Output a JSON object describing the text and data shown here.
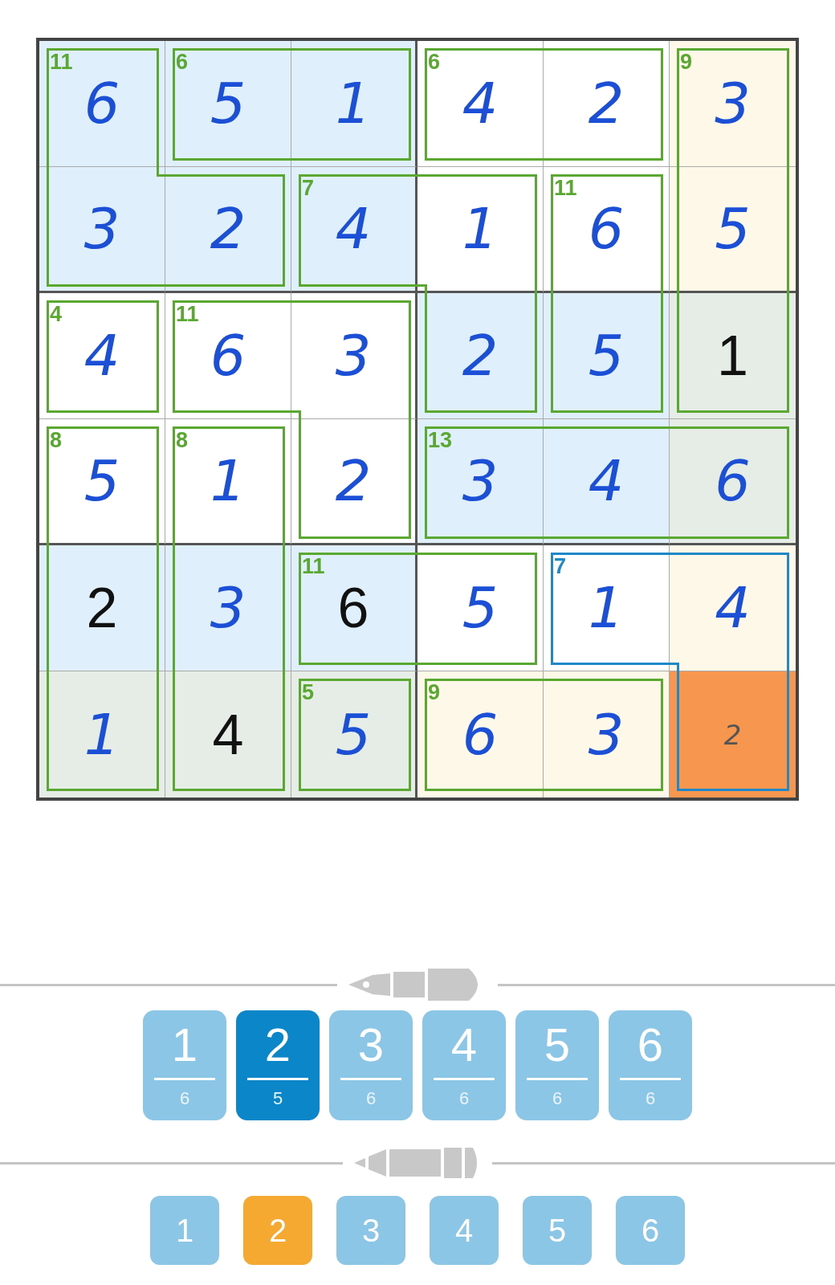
{
  "grid": {
    "rows": [
      [
        {
          "value": "6",
          "kind": "entered",
          "color": "#dfeffb",
          "selected": false,
          "cage_sum": "11",
          "cage_selected": false,
          "edges": {
            "top": true,
            "right": true,
            "bottom": false,
            "left": true
          }
        },
        {
          "value": "5",
          "kind": "entered",
          "color": "#dfeffb",
          "selected": false,
          "cage_sum": "6",
          "cage_selected": false,
          "edges": {
            "top": true,
            "right": false,
            "bottom": true,
            "left": true
          }
        },
        {
          "value": "1",
          "kind": "entered",
          "color": "#dfeffb",
          "selected": false,
          "cage_selected": false,
          "edges": {
            "top": true,
            "right": true,
            "bottom": true,
            "left": false
          }
        },
        {
          "value": "4",
          "kind": "entered",
          "color": "#ffffff",
          "selected": false,
          "cage_sum": "6",
          "cage_selected": false,
          "edges": {
            "top": true,
            "right": false,
            "bottom": true,
            "left": true
          }
        },
        {
          "value": "2",
          "kind": "entered",
          "color": "#ffffff",
          "selected": false,
          "cage_selected": false,
          "edges": {
            "top": true,
            "right": true,
            "bottom": true,
            "left": false
          }
        },
        {
          "value": "3",
          "kind": "entered",
          "color": "#fdf8e8",
          "selected": false,
          "cage_sum": "9",
          "cage_selected": false,
          "edges": {
            "top": true,
            "right": true,
            "bottom": false,
            "left": true
          }
        }
      ],
      [
        {
          "value": "3",
          "kind": "entered",
          "color": "#dfeffb",
          "selected": false,
          "cage_selected": false,
          "edges": {
            "top": false,
            "right": false,
            "bottom": true,
            "left": true
          }
        },
        {
          "value": "2",
          "kind": "entered",
          "color": "#dfeffb",
          "selected": false,
          "cage_selected": false,
          "edges": {
            "top": true,
            "right": true,
            "bottom": true,
            "left": false
          }
        },
        {
          "value": "4",
          "kind": "entered",
          "color": "#dfeffb",
          "selected": false,
          "cage_sum": "7",
          "cage_selected": false,
          "edges": {
            "top": true,
            "right": false,
            "bottom": true,
            "left": true
          }
        },
        {
          "value": "1",
          "kind": "entered",
          "color": "#ffffff",
          "selected": false,
          "cage_selected": false,
          "edges": {
            "top": true,
            "right": true,
            "bottom": false,
            "left": false
          }
        },
        {
          "value": "6",
          "kind": "entered",
          "color": "#ffffff",
          "selected": false,
          "cage_sum": "11",
          "cage_selected": false,
          "edges": {
            "top": true,
            "right": true,
            "bottom": false,
            "left": true
          }
        },
        {
          "value": "5",
          "kind": "entered",
          "color": "#fdf8e8",
          "selected": false,
          "cage_selected": false,
          "edges": {
            "top": false,
            "right": true,
            "bottom": false,
            "left": true
          }
        }
      ],
      [
        {
          "value": "4",
          "kind": "entered",
          "color": "#ffffff",
          "selected": false,
          "cage_sum": "4",
          "cage_selected": false,
          "edges": {
            "top": true,
            "right": true,
            "bottom": true,
            "left": true
          }
        },
        {
          "value": "6",
          "kind": "entered",
          "color": "#ffffff",
          "selected": false,
          "cage_sum": "11",
          "cage_selected": false,
          "edges": {
            "top": true,
            "right": false,
            "bottom": true,
            "left": true
          }
        },
        {
          "value": "3",
          "kind": "entered",
          "color": "#ffffff",
          "selected": false,
          "cage_selected": false,
          "edges": {
            "top": true,
            "right": true,
            "bottom": false,
            "left": false
          }
        },
        {
          "value": "2",
          "kind": "entered",
          "color": "#dfeffb",
          "selected": false,
          "cage_selected": false,
          "edges": {
            "top": false,
            "right": true,
            "bottom": true,
            "left": true
          }
        },
        {
          "value": "5",
          "kind": "entered",
          "color": "#dfeffb",
          "selected": false,
          "cage_selected": false,
          "edges": {
            "top": false,
            "right": true,
            "bottom": true,
            "left": true
          }
        },
        {
          "value": "1",
          "kind": "given",
          "color": "#e6ece6",
          "selected": false,
          "cage_selected": false,
          "edges": {
            "top": false,
            "right": true,
            "bottom": true,
            "left": true
          }
        }
      ],
      [
        {
          "value": "5",
          "kind": "entered",
          "color": "#ffffff",
          "selected": false,
          "cage_sum": "8",
          "cage_selected": false,
          "edges": {
            "top": true,
            "right": true,
            "bottom": false,
            "left": true
          }
        },
        {
          "value": "1",
          "kind": "entered",
          "color": "#ffffff",
          "selected": false,
          "cage_sum": "8",
          "cage_selected": false,
          "edges": {
            "top": true,
            "right": true,
            "bottom": false,
            "left": true
          }
        },
        {
          "value": "2",
          "kind": "entered",
          "color": "#ffffff",
          "selected": false,
          "cage_selected": false,
          "edges": {
            "top": false,
            "right": true,
            "bottom": true,
            "left": true
          }
        },
        {
          "value": "3",
          "kind": "entered",
          "color": "#dfeffb",
          "selected": false,
          "cage_sum": "13",
          "cage_selected": false,
          "edges": {
            "top": true,
            "right": false,
            "bottom": true,
            "left": true
          }
        },
        {
          "value": "4",
          "kind": "entered",
          "color": "#dfeffb",
          "selected": false,
          "cage_selected": false,
          "edges": {
            "top": true,
            "right": false,
            "bottom": true,
            "left": false
          }
        },
        {
          "value": "6",
          "kind": "entered",
          "color": "#e6ece6",
          "selected": false,
          "cage_selected": false,
          "edges": {
            "top": true,
            "right": true,
            "bottom": true,
            "left": false
          }
        }
      ],
      [
        {
          "value": "2",
          "kind": "given",
          "color": "#dfeffb",
          "selected": false,
          "cage_selected": false,
          "edges": {
            "top": false,
            "right": true,
            "bottom": false,
            "left": true
          }
        },
        {
          "value": "3",
          "kind": "entered",
          "color": "#dfeffb",
          "selected": false,
          "cage_selected": false,
          "edges": {
            "top": false,
            "right": true,
            "bottom": false,
            "left": true
          }
        },
        {
          "value": "6",
          "kind": "given",
          "color": "#dfeffb",
          "selected": false,
          "cage_sum": "11",
          "cage_selected": false,
          "edges": {
            "top": true,
            "right": false,
            "bottom": true,
            "left": true
          }
        },
        {
          "value": "5",
          "kind": "entered",
          "color": "#ffffff",
          "selected": false,
          "cage_selected": false,
          "edges": {
            "top": true,
            "right": true,
            "bottom": true,
            "left": false
          }
        },
        {
          "value": "1",
          "kind": "entered",
          "color": "#ffffff",
          "selected": false,
          "cage_sum": "7",
          "cage_selected": true,
          "edges": {
            "top": true,
            "right": false,
            "bottom": true,
            "left": true
          }
        },
        {
          "value": "4",
          "kind": "entered",
          "color": "#fdf8e8",
          "selected": false,
          "cage_selected": true,
          "edges": {
            "top": true,
            "right": true,
            "bottom": false,
            "left": false
          }
        }
      ],
      [
        {
          "value": "1",
          "kind": "entered",
          "color": "#e6ece6",
          "selected": false,
          "cage_selected": false,
          "edges": {
            "top": false,
            "right": true,
            "bottom": true,
            "left": true
          }
        },
        {
          "value": "4",
          "kind": "given",
          "color": "#e6ece6",
          "selected": false,
          "cage_selected": false,
          "edges": {
            "top": false,
            "right": true,
            "bottom": true,
            "left": true
          }
        },
        {
          "value": "5",
          "kind": "entered",
          "color": "#e6ece6",
          "selected": false,
          "cage_sum": "5",
          "cage_selected": false,
          "edges": {
            "top": true,
            "right": true,
            "bottom": true,
            "left": true
          }
        },
        {
          "value": "6",
          "kind": "entered",
          "color": "#fdf8e8",
          "selected": false,
          "cage_sum": "9",
          "cage_selected": false,
          "edges": {
            "top": true,
            "right": false,
            "bottom": true,
            "left": true
          }
        },
        {
          "value": "3",
          "kind": "entered",
          "color": "#fdf8e8",
          "selected": false,
          "cage_selected": false,
          "edges": {
            "top": true,
            "right": true,
            "bottom": true,
            "left": false
          }
        },
        {
          "value": "2",
          "kind": "note",
          "selected": true,
          "cage_selected": true,
          "edges": {
            "top": false,
            "right": true,
            "bottom": true,
            "left": true
          }
        }
      ]
    ]
  },
  "pen_digits": [
    {
      "digit": "1",
      "count": "6",
      "selected": false
    },
    {
      "digit": "2",
      "count": "5",
      "selected": true
    },
    {
      "digit": "3",
      "count": "6",
      "selected": false
    },
    {
      "digit": "4",
      "count": "6",
      "selected": false
    },
    {
      "digit": "5",
      "count": "6",
      "selected": false
    },
    {
      "digit": "6",
      "count": "6",
      "selected": false
    }
  ],
  "pencil_digits": [
    {
      "digit": "1",
      "selected": false
    },
    {
      "digit": "2",
      "selected": true
    },
    {
      "digit": "3",
      "selected": false
    },
    {
      "digit": "4",
      "selected": false
    },
    {
      "digit": "5",
      "selected": false
    },
    {
      "digit": "6",
      "selected": false
    }
  ]
}
